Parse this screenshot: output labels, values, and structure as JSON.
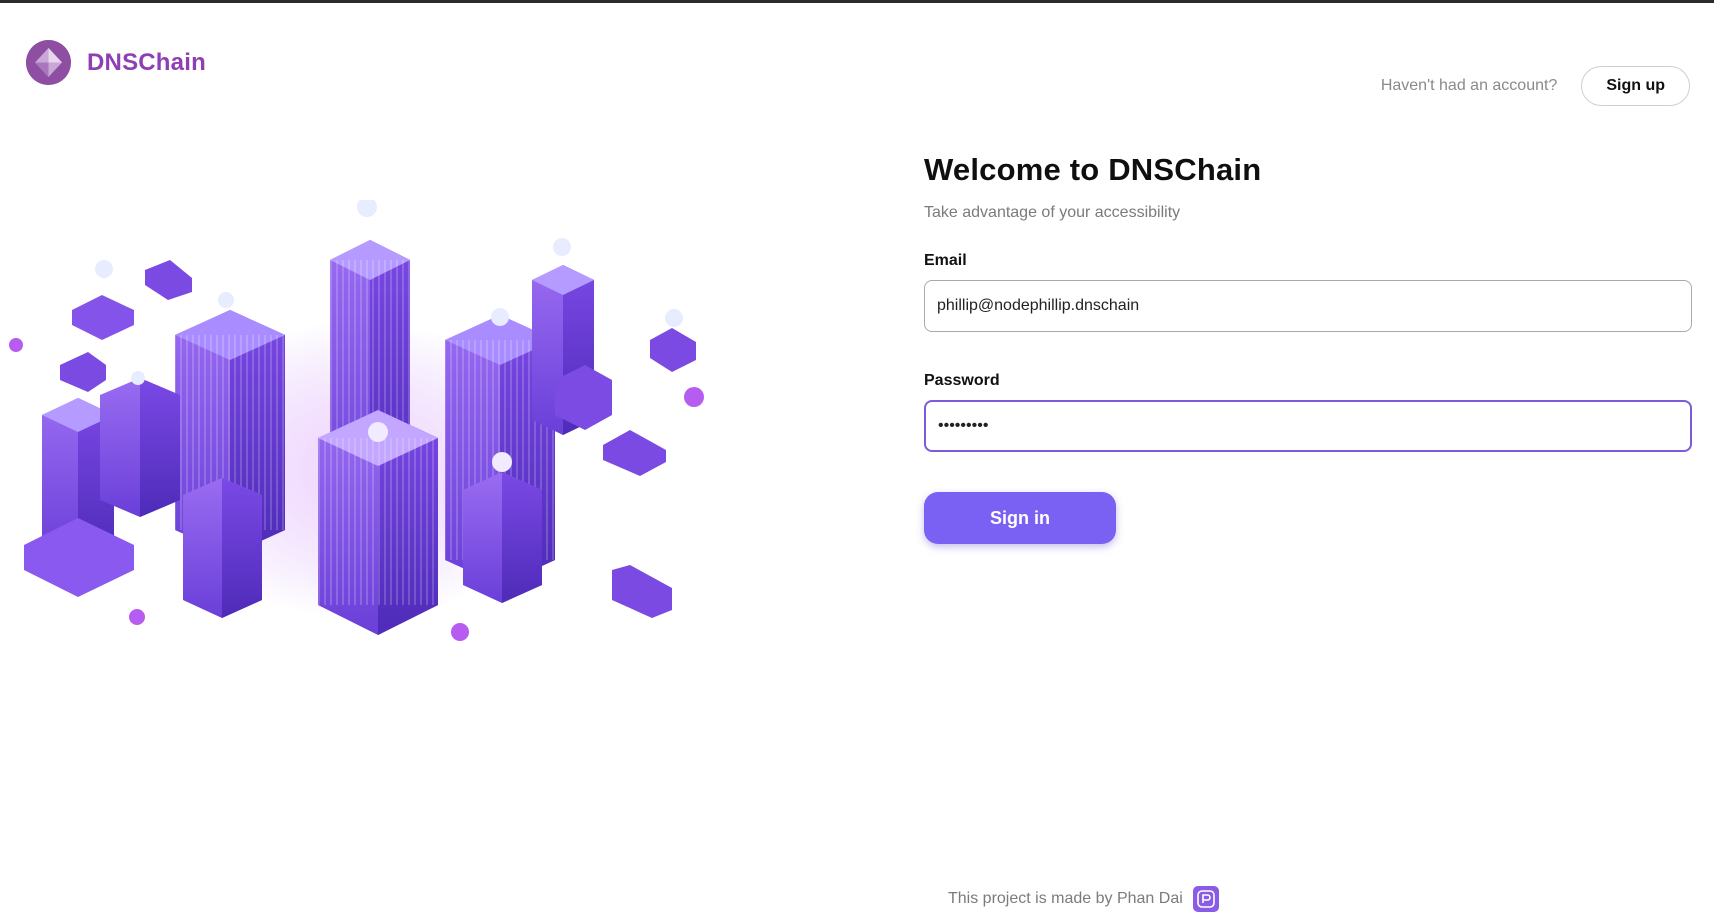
{
  "app": {
    "brand_name": "DNSChain"
  },
  "header": {
    "question": "Haven't had an account?",
    "signup_label": "Sign up"
  },
  "form": {
    "title": "Welcome to DNSChain",
    "subtitle": "Take advantage of your accessibility",
    "email_label": "Email",
    "email_value": "phillip@nodephillip.dnschain",
    "password_label": "Password",
    "password_value": "•••••••••",
    "signin_label": "Sign in"
  },
  "footer": {
    "text": "This project is made by Phan Dai"
  },
  "colors": {
    "brand": "#8e3fb4",
    "accent": "#7a61f4",
    "focus_border": "#7c5ad8"
  },
  "icons": {
    "brand_logo": "diamond-logo-icon",
    "footer_badge": "author-badge-icon",
    "illustration": "isometric-city-illustration"
  }
}
